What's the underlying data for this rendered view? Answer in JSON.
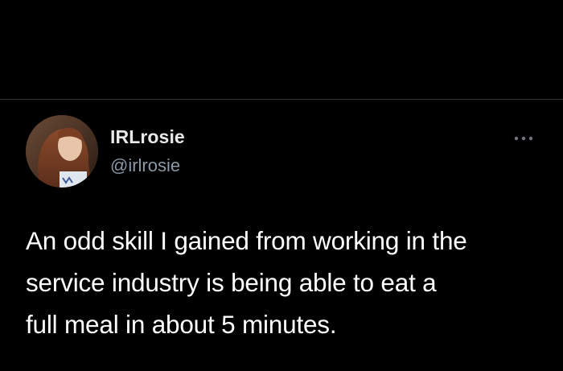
{
  "tweet": {
    "author": {
      "display_name": "IRLrosie",
      "handle": "@irlrosie",
      "avatar_icon": "profile-photo"
    },
    "more_icon": "more-options-icon",
    "text_lines": [
      "An odd skill I gained from working in the",
      "service industry is being able to eat a",
      "full meal in about 5 minutes."
    ]
  },
  "colors": {
    "background": "#000000",
    "divider": "#2f3336",
    "primary_text": "#ffffff",
    "secondary_text": "#8b98a5"
  }
}
